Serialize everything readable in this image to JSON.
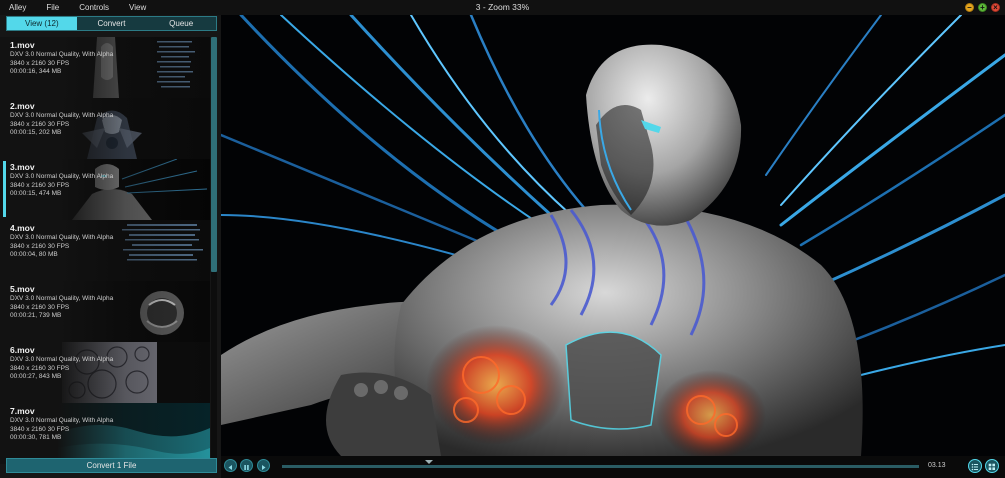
{
  "menu": {
    "items": [
      "Alley",
      "File",
      "Controls",
      "View"
    ]
  },
  "window": {
    "title": "3 - Zoom 33%"
  },
  "tabs": [
    {
      "label": "View (12)",
      "active": true
    },
    {
      "label": "Convert",
      "active": false
    },
    {
      "label": "Queue",
      "active": false
    }
  ],
  "files": [
    {
      "name": "1.mov",
      "codec": "DXV 3.0 Normal Quality, With Alpha",
      "resolution": "3840 x 2160 30 FPS",
      "info": "00:00:16, 344 MB",
      "selected": false
    },
    {
      "name": "2.mov",
      "codec": "DXV 3.0 Normal Quality, With Alpha",
      "resolution": "3840 x 2160 30 FPS",
      "info": "00:00:15, 202 MB",
      "selected": false
    },
    {
      "name": "3.mov",
      "codec": "DXV 3.0 Normal Quality, With Alpha",
      "resolution": "3840 x 2160 30 FPS",
      "info": "00:00:15, 474 MB",
      "selected": true
    },
    {
      "name": "4.mov",
      "codec": "DXV 3.0 Normal Quality, With Alpha",
      "resolution": "3840 x 2160 30 FPS",
      "info": "00:00:04, 80 MB",
      "selected": false
    },
    {
      "name": "5.mov",
      "codec": "DXV 3.0 Normal Quality, With Alpha",
      "resolution": "3840 x 2160 30 FPS",
      "info": "00:00:21, 739 MB",
      "selected": false
    },
    {
      "name": "6.mov",
      "codec": "DXV 3.0 Normal Quality, With Alpha",
      "resolution": "3840 x 2160 30 FPS",
      "info": "00:00:27, 843 MB",
      "selected": false
    },
    {
      "name": "7.mov",
      "codec": "DXV 3.0 Normal Quality, With Alpha",
      "resolution": "3840 x 2160 30 FPS",
      "info": "00:00:30, 781 MB",
      "selected": false
    }
  ],
  "sidebar": {
    "convert_label": "Convert 1 File"
  },
  "transport": {
    "timecode": "03.13",
    "progress": 0.23
  },
  "colors": {
    "accent": "#53d8ea",
    "accent_dark": "#1e6470",
    "background": "#161616"
  },
  "icons": {
    "prev": "previous-frame-icon",
    "pause": "pause-icon",
    "next": "next-frame-icon",
    "list": "list-icon",
    "grid": "grid-icon"
  }
}
